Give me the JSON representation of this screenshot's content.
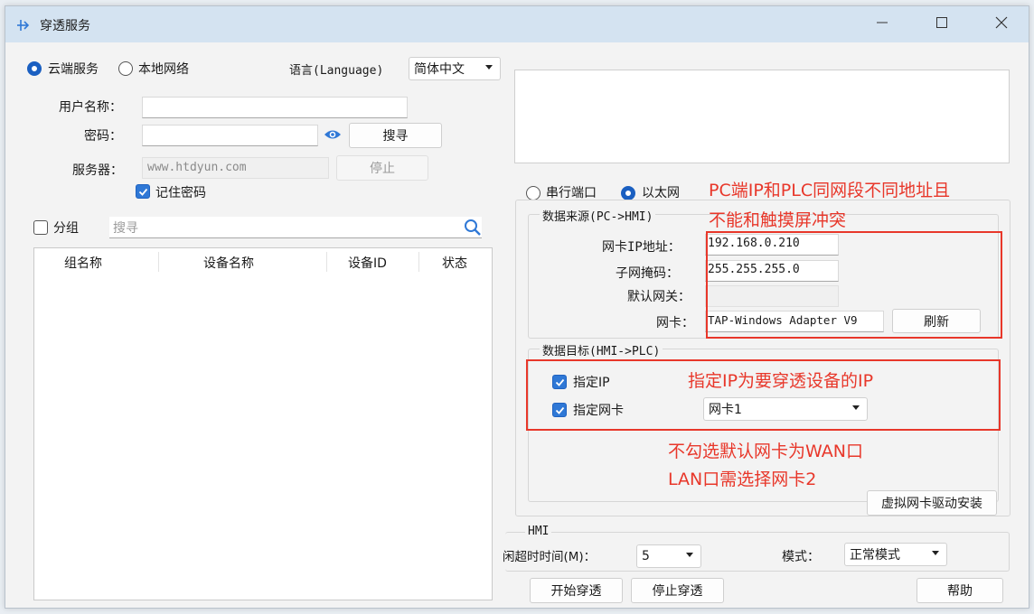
{
  "window": {
    "title": "穿透服务",
    "icons": {
      "app": "arrow-transfer-icon",
      "minimize": "minimize-icon",
      "maximize": "maximize-icon",
      "close": "close-icon"
    }
  },
  "left": {
    "mode": {
      "cloud_label": "云端服务",
      "local_label": "本地网络",
      "selected": "cloud"
    },
    "language": {
      "label": "语言(Language)",
      "value": "简体中文"
    },
    "username": {
      "label": "用户名称：",
      "value": ""
    },
    "password": {
      "label": "密码：",
      "value": "",
      "show_icon": "eye-icon"
    },
    "search_button": "搜寻",
    "server": {
      "label": "服务器：",
      "value": "www.htdyun.com"
    },
    "stop_button": "停止",
    "remember": {
      "label": "记住密码",
      "checked": true
    },
    "group": {
      "label": "分组",
      "checked": false
    },
    "search": {
      "placeholder": "搜寻",
      "icon": "search-icon"
    },
    "table": {
      "columns": [
        "组名称",
        "设备名称",
        "设备ID",
        "状态"
      ],
      "rows": []
    }
  },
  "right": {
    "port_mode": {
      "serial_label": "串行端口",
      "ethernet_label": "以太网",
      "selected": "ethernet"
    },
    "source": {
      "title": "数据来源(PC->HMI)",
      "nic_ip_label": "网卡IP地址：",
      "nic_ip": "192.168.0.210",
      "subnet_label": "子网掩码：",
      "subnet": "255.255.255.0",
      "gateway_label": "默认网关：",
      "gateway": "",
      "nic_label": "网卡：",
      "nic": "TAP-Windows Adapter V9",
      "refresh_button": "刷新"
    },
    "target": {
      "title": "数据目标(HMI->PLC)",
      "specify_ip": {
        "label": "指定IP",
        "checked": true
      },
      "specify_nic": {
        "label": "指定网卡",
        "checked": true
      },
      "nic_select": "网卡1"
    },
    "install_button": "虚拟网卡驱动安装",
    "hmi": {
      "title": "HMI",
      "timeout_label": "闲超时时间(M)：",
      "timeout_value": "5",
      "mode_label": "模式：",
      "mode_value": "正常模式"
    }
  },
  "bottom": {
    "start_button": "开始穿透",
    "stop_button": "停止穿透",
    "help_button": "帮助"
  },
  "annotations": {
    "a1_line1": "PC端IP和PLC同网段不同地址且",
    "a1_line2": "不能和触摸屏冲突",
    "a2": "指定IP为要穿透设备的IP",
    "a3_line1": "不勾选默认网卡为WAN口",
    "a3_line2": "LAN口需选择网卡2",
    "color": "#e8372a"
  },
  "colors": {
    "accent": "#1a5fc1",
    "titlebar": "#d4e3f1",
    "annotation": "#e8372a"
  }
}
